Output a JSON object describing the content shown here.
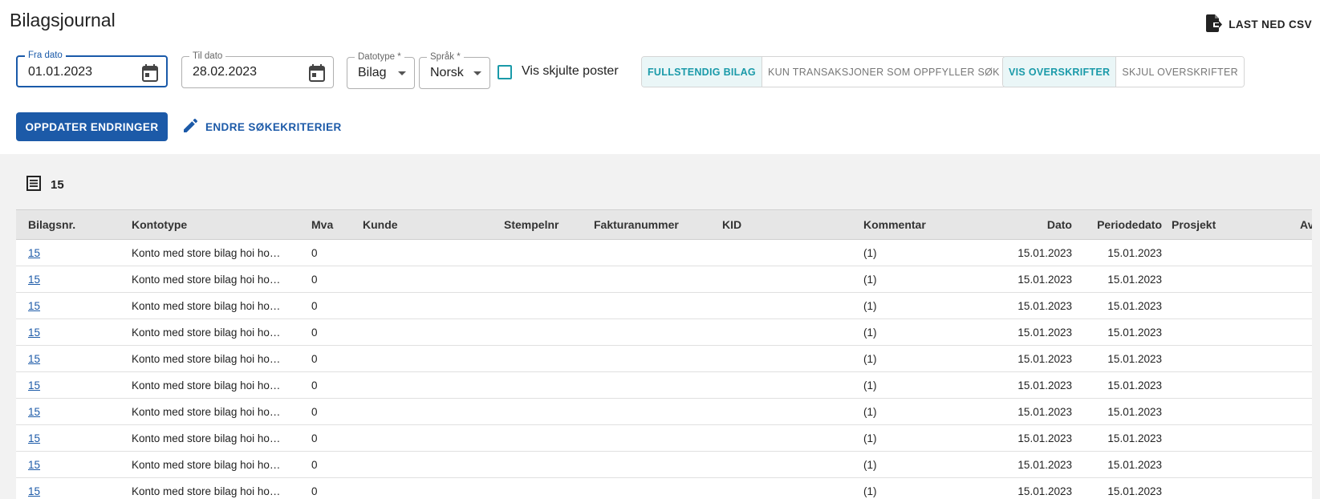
{
  "header": {
    "title": "Bilagsjournal",
    "csv_label": "LAST NED CSV"
  },
  "filters": {
    "fra_dato": {
      "label": "Fra dato",
      "value": "01.01.2023"
    },
    "til_dato": {
      "label": "Til dato",
      "value": "28.02.2023"
    },
    "datotype": {
      "label": "Datotype *",
      "value": "Bilag"
    },
    "sprak": {
      "label": "Språk *",
      "value": "Norsk"
    },
    "vis_skjulte_label": "Vis skjulte poster",
    "view_toggle": [
      {
        "label": "FULLSTENDIG BILAG",
        "selected": true
      },
      {
        "label": "KUN TRANSAKSJONER SOM OPPFYLLER SØK",
        "selected": false
      }
    ],
    "header_toggle": [
      {
        "label": "VIS OVERSKRIFTER",
        "selected": true
      },
      {
        "label": "SKJUL OVERSKRIFTER",
        "selected": false
      }
    ]
  },
  "actions": {
    "oppdater_label": "OPPDATER ENDRINGER",
    "endre_label": "ENDRE SØKEKRITERIER"
  },
  "results": {
    "count": "15",
    "columns": [
      "Bilagsnr.",
      "Kontotype",
      "Mva",
      "Kunde",
      "Stempelnr",
      "Fakturanummer",
      "KID",
      "Kommentar",
      "Dato",
      "Periodedato",
      "Prosjekt",
      "Av"
    ],
    "rows": [
      {
        "bilagsnr": "15",
        "kontotype": "Konto med store bilag hoi ho…",
        "mva": "0",
        "kommentar": "(1)",
        "dato": "15.01.2023",
        "periodedato": "15.01.2023"
      },
      {
        "bilagsnr": "15",
        "kontotype": "Konto med store bilag hoi ho…",
        "mva": "0",
        "kommentar": "(1)",
        "dato": "15.01.2023",
        "periodedato": "15.01.2023"
      },
      {
        "bilagsnr": "15",
        "kontotype": "Konto med store bilag hoi ho…",
        "mva": "0",
        "kommentar": "(1)",
        "dato": "15.01.2023",
        "periodedato": "15.01.2023"
      },
      {
        "bilagsnr": "15",
        "kontotype": "Konto med store bilag hoi ho…",
        "mva": "0",
        "kommentar": "(1)",
        "dato": "15.01.2023",
        "periodedato": "15.01.2023"
      },
      {
        "bilagsnr": "15",
        "kontotype": "Konto med store bilag hoi ho…",
        "mva": "0",
        "kommentar": "(1)",
        "dato": "15.01.2023",
        "periodedato": "15.01.2023"
      },
      {
        "bilagsnr": "15",
        "kontotype": "Konto med store bilag hoi ho…",
        "mva": "0",
        "kommentar": "(1)",
        "dato": "15.01.2023",
        "periodedato": "15.01.2023"
      },
      {
        "bilagsnr": "15",
        "kontotype": "Konto med store bilag hoi ho…",
        "mva": "0",
        "kommentar": "(1)",
        "dato": "15.01.2023",
        "periodedato": "15.01.2023"
      },
      {
        "bilagsnr": "15",
        "kontotype": "Konto med store bilag hoi ho…",
        "mva": "0",
        "kommentar": "(1)",
        "dato": "15.01.2023",
        "periodedato": "15.01.2023"
      },
      {
        "bilagsnr": "15",
        "kontotype": "Konto med store bilag hoi ho…",
        "mva": "0",
        "kommentar": "(1)",
        "dato": "15.01.2023",
        "periodedato": "15.01.2023"
      },
      {
        "bilagsnr": "15",
        "kontotype": "Konto med store bilag hoi ho…",
        "mva": "0",
        "kommentar": "(1)",
        "dato": "15.01.2023",
        "periodedato": "15.01.2023"
      }
    ]
  },
  "colors": {
    "primary": "#1c5aa8",
    "accent_teal": "#1a9aa9",
    "panel_bg": "#f2f2f2",
    "header_bg": "#e6e6e6"
  }
}
